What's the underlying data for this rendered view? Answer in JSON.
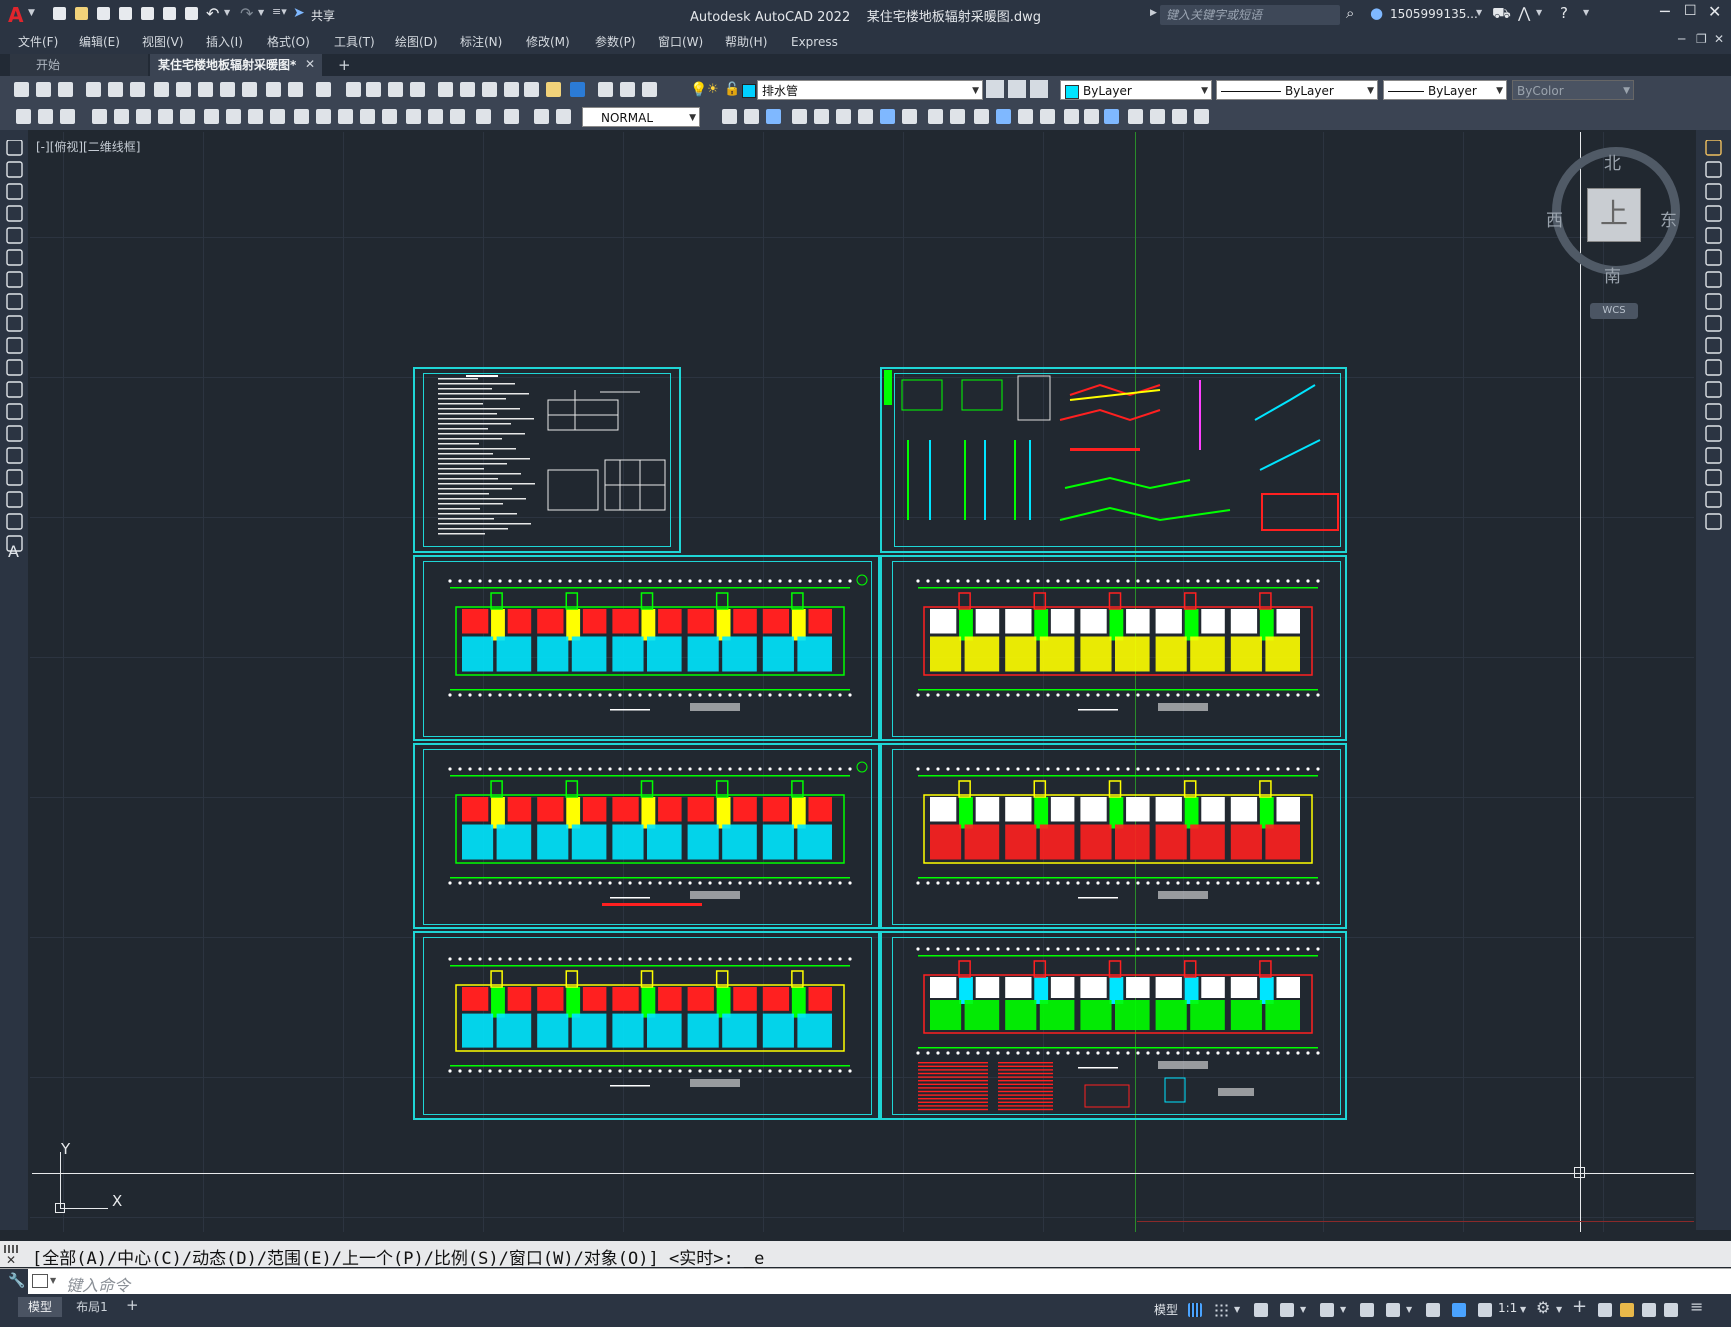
{
  "app": {
    "logo": "A",
    "title": "Autodesk AutoCAD 2022",
    "document": "某住宅楼地板辐射采暖图.dwg",
    "share_label": "共享",
    "search_placeholder": "键入关键字或短语",
    "user": "1505999135...",
    "window_controls": [
      "minimize-icon",
      "maximize-icon",
      "close-icon"
    ]
  },
  "menu": {
    "items": [
      "文件(F)",
      "编辑(E)",
      "视图(V)",
      "插入(I)",
      "格式(O)",
      "工具(T)",
      "绘图(D)",
      "标注(N)",
      "修改(M)",
      "参数(P)",
      "窗口(W)",
      "帮助(H)",
      "Express"
    ]
  },
  "tabs": {
    "start": "开始",
    "drawing": "某住宅楼地板辐射采暖图*",
    "add": "+"
  },
  "toolbar": {
    "layer_value": "排水管",
    "layer_color": "#00d0ff",
    "color_value": "ByLayer",
    "linetype_value": "ByLayer",
    "lineweight_value": "ByLayer",
    "plotstyle_value": "ByColor",
    "textstyle_value": "NORMAL"
  },
  "viewport": {
    "label": "[-][俯视][二维线框]",
    "compass": {
      "north": "北",
      "south": "南",
      "east": "东",
      "west": "西",
      "face": "上"
    },
    "wcs": "WCS",
    "ucs_x": "X",
    "ucs_y": "Y"
  },
  "command": {
    "history": "[全部(A)/中心(C)/动态(D)/范围(E)/上一个(P)/比例(S)/窗口(W)/对象(O)] <实时>: _e",
    "placeholder": "键入命令"
  },
  "status": {
    "model_tab": "模型",
    "layout_tab": "布局1",
    "add_tab": "+",
    "model_label": "模型",
    "scale": "1:1"
  },
  "colors": {
    "frame": "#1fd6d6",
    "wall": "#00ff00",
    "red": "#ff2020",
    "yellow": "#ffff00",
    "cyan": "#00e5ff",
    "magenta": "#ff40ff"
  }
}
